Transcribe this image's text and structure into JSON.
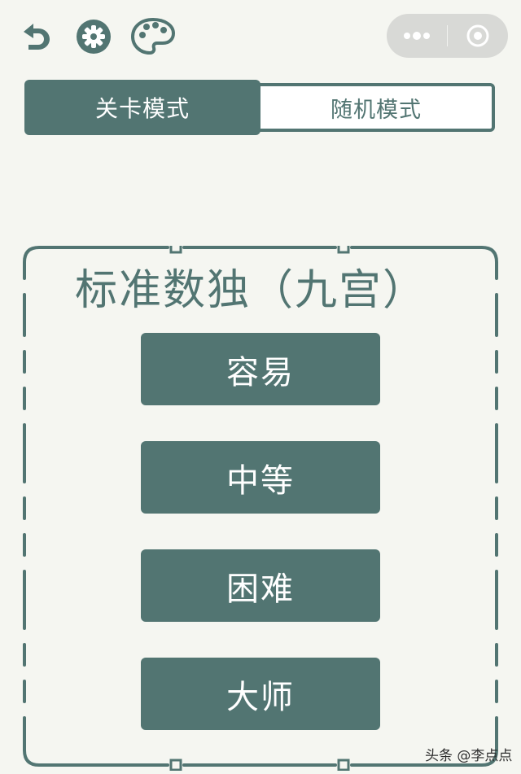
{
  "toolbar": {
    "back_icon": "back-arrow-icon",
    "settings_icon": "gear-icon",
    "theme_icon": "palette-icon",
    "more_icon": "more-dots-icon",
    "close_icon": "target-circle-icon",
    "accent_color": "#527572"
  },
  "tabs": [
    {
      "label": "关卡模式",
      "selected": true
    },
    {
      "label": "随机模式",
      "selected": false
    }
  ],
  "board": {
    "title": "标准数独（九宫）",
    "buttons": [
      {
        "label": "容易"
      },
      {
        "label": "中等"
      },
      {
        "label": "困难"
      },
      {
        "label": "大师"
      }
    ]
  },
  "watermark": "头条 @李点点",
  "colors": {
    "background": "#f5f6f1",
    "primary": "#527572",
    "capsule": "#d8d9d6"
  }
}
